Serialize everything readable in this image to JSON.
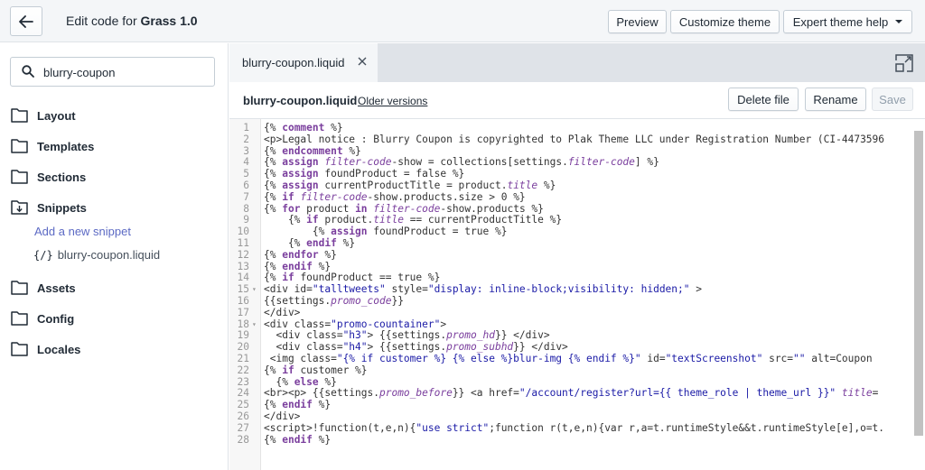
{
  "topbar": {
    "title_prefix": "Edit code for ",
    "theme_name": "Grass 1.0",
    "preview": "Preview",
    "customize": "Customize theme",
    "expert": "Expert theme help"
  },
  "sidebar": {
    "search_value": "blurry-coupon",
    "folders": [
      "Layout",
      "Templates",
      "Sections",
      "Snippets",
      "Assets",
      "Config",
      "Locales"
    ],
    "add_snippet": "Add a new snippet",
    "snippet_glyph": "{/}",
    "snippet_file": "blurry-coupon.liquid"
  },
  "editor": {
    "tab_label": "blurry-coupon.liquid",
    "file_name": "blurry-coupon.liquid",
    "older_versions": "Older versions",
    "delete": "Delete file",
    "rename": "Rename",
    "save": "Save",
    "lines": [
      "{% comment %}",
      "<p>Legal notice : Blurry Coupon is copyrighted to Plak Theme LLC under Registration Number (CI-4473596",
      "{% endcomment %}",
      "{% assign filter-code-show = collections[settings.filter-code] %}",
      "{% assign foundProduct = false %}",
      "{% assign currentProductTitle = product.title %}",
      "{% if filter-code-show.products.size > 0 %}",
      "{% for product in filter-code-show.products %}",
      "    {% if product.title == currentProductTitle %}",
      "        {% assign foundProduct = true %}",
      "    {% endif %}",
      "{% endfor %}",
      "{% endif %}",
      "{% if foundProduct == true %}",
      "<div id=\"talltweets\" style=\"display: inline-block;visibility: hidden;\" >",
      "{{settings.promo_code}}",
      "</div>",
      "<div class=\"promo-countainer\">",
      "  <div class=\"h3\"> {{settings.promo_hd}} </div>",
      "  <div class=\"h4\"> {{settings.promo_subhd}} </div>",
      " <img class=\"{% if customer %} {% else %}blur-img {% endif %}\" id=\"textScreenshot\" src=\"\" alt=\"Coupon",
      "{% if customer %}",
      "  {% else %}",
      "<br><p> {{settings.promo_before}} <a href=\"/account/register?url={{ theme_role | theme_url }}\" title=\"",
      "{% endif %}",
      "</div>",
      "<script>!function(t,e,n){\"use strict\";function r(t,e,n){var r,a=t.runtimeStyle&&t.runtimeStyle[e],o=t.",
      "{% endif %}"
    ]
  }
}
